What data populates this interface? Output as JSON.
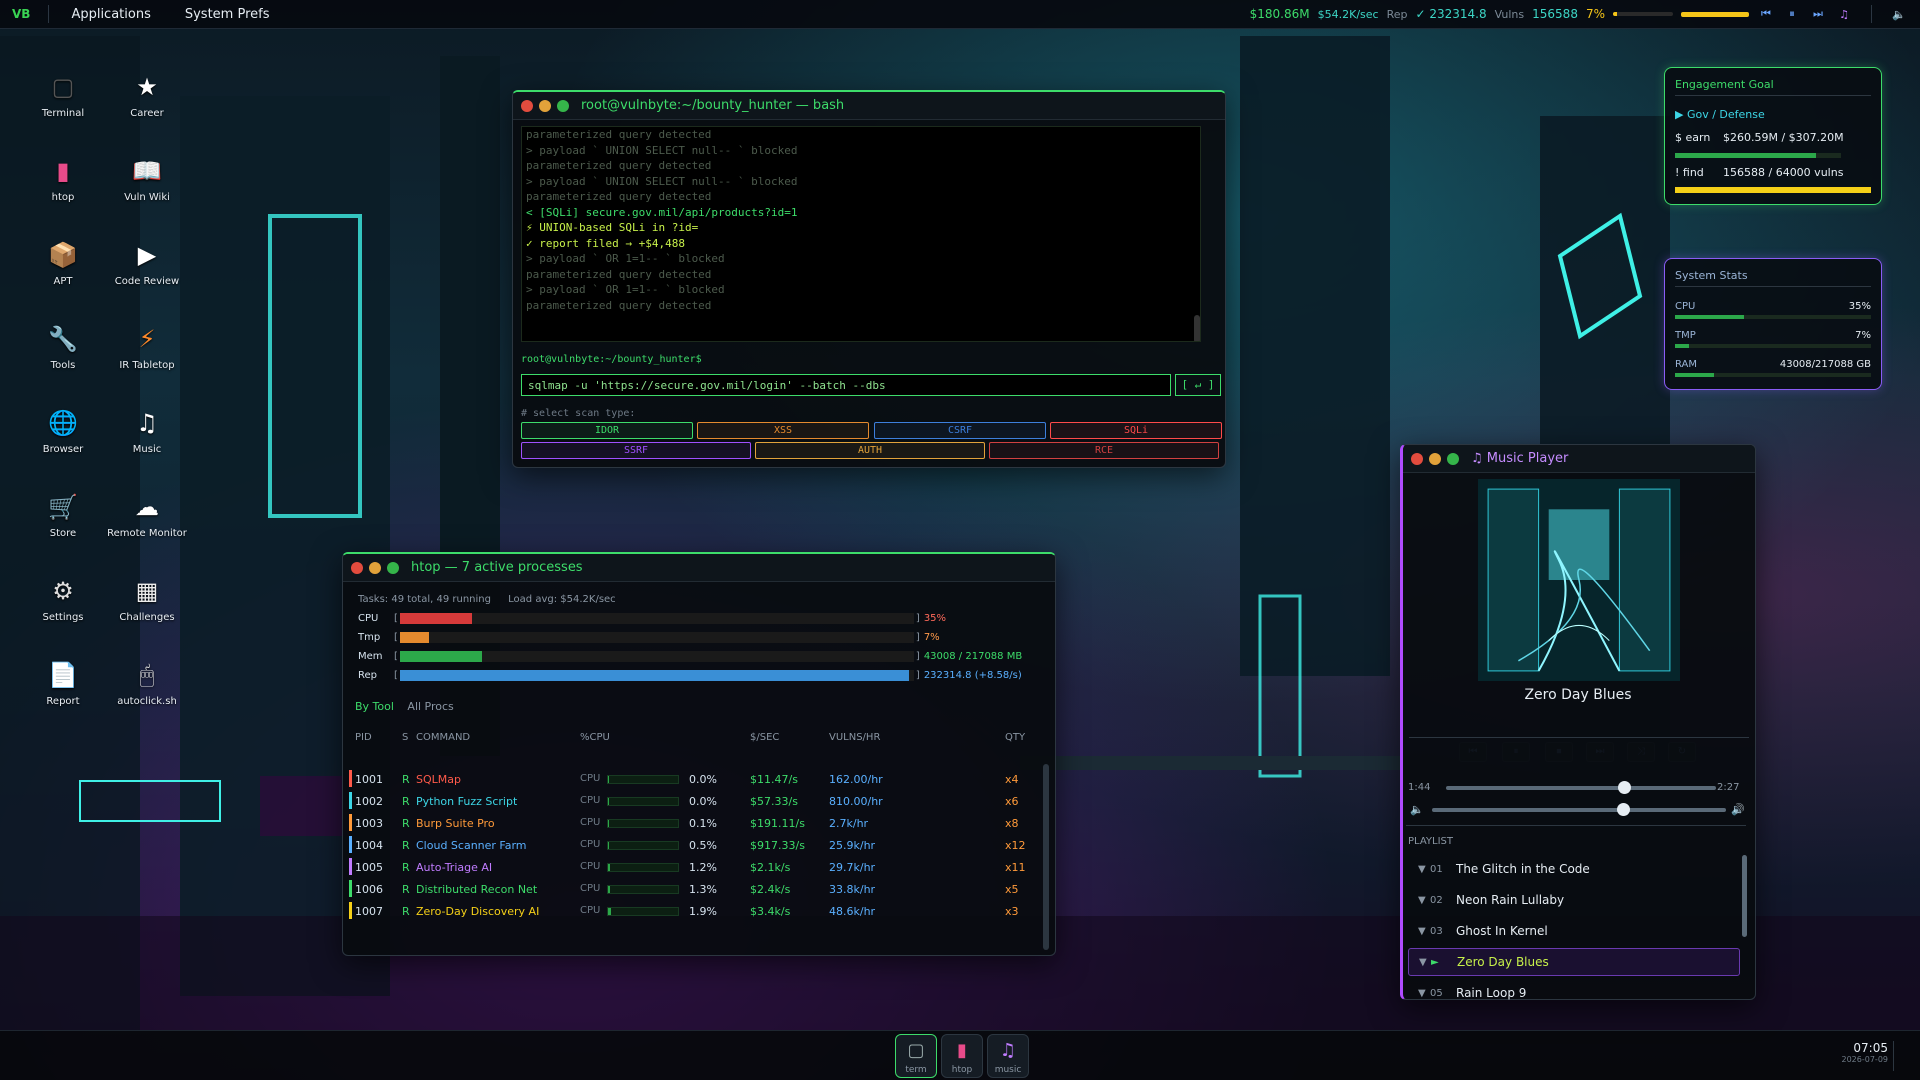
{
  "topbar": {
    "logo": "VB",
    "menu": [
      "Applications",
      "System Prefs"
    ],
    "money": "$180.86M",
    "rate": "$54.2K/sec",
    "rep_label": "Rep",
    "rep_value": "✓ 232314.8",
    "vulns_label": "Vulns",
    "vulns_value": "156588",
    "pct": "7%"
  },
  "desktop_icons": [
    {
      "label": "Terminal",
      "icon": "terminal-icon"
    },
    {
      "label": "Career",
      "icon": "star-icon"
    },
    {
      "label": "htop",
      "icon": "htop-icon"
    },
    {
      "label": "Vuln Wiki",
      "icon": "book-icon"
    },
    {
      "label": "APT",
      "icon": "package-icon"
    },
    {
      "label": "Code Review",
      "icon": "play-icon"
    },
    {
      "label": "Tools",
      "icon": "wrench-icon"
    },
    {
      "label": "IR Tabletop",
      "icon": "lightning-icon"
    },
    {
      "label": "Browser",
      "icon": "globe-icon"
    },
    {
      "label": "Music",
      "icon": "music-note-icon"
    },
    {
      "label": "Store",
      "icon": "cart-icon"
    },
    {
      "label": "Remote Monitor",
      "icon": "cloud-icon"
    },
    {
      "label": "Settings",
      "icon": "gear-icon"
    },
    {
      "label": "Challenges",
      "icon": "checkerboard-icon"
    },
    {
      "label": "Report",
      "icon": "document-icon"
    },
    {
      "label": "autoclick.sh",
      "icon": "mouse-icon"
    }
  ],
  "terminal": {
    "title": "root@vulnbyte:~/bounty_hunter — bash",
    "lines": [
      {
        "t": "parameterized query detected",
        "k": "dim"
      },
      {
        "t": "> payload ` UNION SELECT null-- ` blocked",
        "k": "dim"
      },
      {
        "t": "parameterized query detected",
        "k": "dim"
      },
      {
        "t": "> payload ` UNION SELECT null-- ` blocked",
        "k": "dim"
      },
      {
        "t": "parameterized query detected",
        "k": "dim"
      },
      {
        "t": "< [SQLi]  secure.gov.mil/api/products?id=1",
        "k": "sql"
      },
      {
        "t": "  ⚡  UNION-based SQLi in ?id=",
        "k": "hi"
      },
      {
        "t": "  ✓ report filed → +$4,488",
        "k": "hi"
      },
      {
        "t": "> payload ` OR 1=1-- ` blocked",
        "k": "dim"
      },
      {
        "t": "parameterized query detected",
        "k": "dim"
      },
      {
        "t": "> payload ` OR 1=1-- ` blocked",
        "k": "dim"
      },
      {
        "t": "parameterized query detected",
        "k": "dim"
      }
    ],
    "prompt": "root@vulnbyte:~/bounty_hunter$",
    "command": "sqlmap -u 'https://secure.gov.mil/login' --batch --dbs",
    "run_label": "[ ↵ ]",
    "scan_label": "# select scan type:",
    "scan_types": [
      {
        "label": "IDOR",
        "color": "#3ddc6a"
      },
      {
        "label": "XSS",
        "color": "#e58a2e"
      },
      {
        "label": "CSRF",
        "color": "#3d7fdc"
      },
      {
        "label": "SQLi",
        "color": "#ff4a4a"
      },
      {
        "label": "SSRF",
        "color": "#a050ff"
      },
      {
        "label": "AUTH",
        "color": "#e2a23a"
      },
      {
        "label": "RCE",
        "color": "#d04040"
      }
    ]
  },
  "htop": {
    "title": "htop — 7 active processes",
    "tasks": "Tasks: 49 total, 49 running",
    "load": "Load avg: $54.2K/sec",
    "meters": [
      {
        "label": "CPU",
        "fraction": 0.14,
        "value": "35%",
        "color": "#d63a3a",
        "vcolor": "#ff6a5a"
      },
      {
        "label": "Tmp",
        "fraction": 0.057,
        "value": "7%",
        "color": "#e58a2e",
        "vcolor": "#ff9a4a"
      },
      {
        "label": "Mem",
        "fraction": 0.16,
        "value": "43008 / 217088 MB",
        "color": "#2ca84a",
        "vcolor": "#3ddc6a"
      },
      {
        "label": "Rep",
        "fraction": 0.99,
        "value": "232314.8 (+8.58/s)",
        "color": "#3a8fd6",
        "vcolor": "#5ab0ff"
      }
    ],
    "tabs": [
      "By Tool",
      "All Procs"
    ],
    "columns": [
      "PID",
      "S",
      "COMMAND",
      "%CPU",
      "$/SEC",
      "VULNS/HR",
      "QTY"
    ],
    "processes": [
      {
        "pid": "1001",
        "s": "R",
        "cmd": "SQLMap",
        "cpu_label": "CPU",
        "cpu": "0.0%",
        "cpu_frac": 0.0,
        "sec": "$11.47/s",
        "vph": "162.00/hr",
        "qty": "x4",
        "color": "#ff5a4a"
      },
      {
        "pid": "1002",
        "s": "R",
        "cmd": "Python Fuzz Script",
        "cpu_label": "CPU",
        "cpu": "0.0%",
        "cpu_frac": 0.0,
        "sec": "$57.33/s",
        "vph": "810.00/hr",
        "qty": "x6",
        "color": "#3dd6e6"
      },
      {
        "pid": "1003",
        "s": "R",
        "cmd": "Burp Suite Pro",
        "cpu_label": "CPU",
        "cpu": "0.1%",
        "cpu_frac": 0.01,
        "sec": "$191.11/s",
        "vph": "2.7k/hr",
        "qty": "x8",
        "color": "#ff9a3a"
      },
      {
        "pid": "1004",
        "s": "R",
        "cmd": "Cloud Scanner Farm",
        "cpu_label": "CPU",
        "cpu": "0.5%",
        "cpu_frac": 0.02,
        "sec": "$917.33/s",
        "vph": "25.9k/hr",
        "qty": "x12",
        "color": "#5ab0ff"
      },
      {
        "pid": "1005",
        "s": "R",
        "cmd": "Auto-Triage AI",
        "cpu_label": "CPU",
        "cpu": "1.2%",
        "cpu_frac": 0.03,
        "sec": "$2.1k/s",
        "vph": "29.7k/hr",
        "qty": "x11",
        "color": "#c07cff"
      },
      {
        "pid": "1006",
        "s": "R",
        "cmd": "Distributed Recon Net",
        "cpu_label": "CPU",
        "cpu": "1.3%",
        "cpu_frac": 0.03,
        "sec": "$2.4k/s",
        "vph": "33.8k/hr",
        "qty": "x5",
        "color": "#3ddc6a"
      },
      {
        "pid": "1007",
        "s": "R",
        "cmd": "Zero-Day Discovery AI",
        "cpu_label": "CPU",
        "cpu": "1.9%",
        "cpu_frac": 0.04,
        "sec": "$3.4k/s",
        "vph": "48.6k/hr",
        "qty": "x3",
        "color": "#f5d018"
      }
    ]
  },
  "goal": {
    "title": "Engagement Goal",
    "category": "▶ Gov / Defense",
    "earn_label": "$  earn",
    "earn_value": "$260.59M / $307.20M",
    "earn_frac": 0.85,
    "find_label": "!  find",
    "find_value": "156588 / 64000 vulns",
    "find_frac": 1.0
  },
  "sysstats": {
    "title": "System Stats",
    "rows": [
      {
        "label": "CPU",
        "value": "35%",
        "frac": 0.35
      },
      {
        "label": "TMP",
        "value": "7%",
        "frac": 0.07
      },
      {
        "label": "RAM",
        "value": "43008/217088 GB",
        "frac": 0.2
      }
    ]
  },
  "music": {
    "title": "♫  Music Player",
    "track": "Zero Day Blues",
    "elapsed": "1:44",
    "duration": "2:27",
    "progress": 0.66,
    "volume": 0.65,
    "playlist_label": "PLAYLIST",
    "playlist": [
      {
        "n": "01",
        "title": "The Glitch in the Code",
        "active": false
      },
      {
        "n": "02",
        "title": "Neon Rain Lullaby",
        "active": false
      },
      {
        "n": "03",
        "title": "Ghost In Kernel",
        "active": false
      },
      {
        "n": "►",
        "title": "Zero Day Blues",
        "active": true
      },
      {
        "n": "05",
        "title": "Rain Loop 9",
        "active": false
      }
    ]
  },
  "dock": {
    "items": [
      {
        "label": "term",
        "icon": "terminal-icon"
      },
      {
        "label": "htop",
        "icon": "htop-icon"
      },
      {
        "label": "music",
        "icon": "music-note-icon"
      }
    ],
    "time": "07:05",
    "date": "2026-07-09"
  },
  "colors": {
    "accent": "#3ddc6a",
    "music_accent": "#b04cff",
    "stats_accent": "#8a5cf5"
  }
}
